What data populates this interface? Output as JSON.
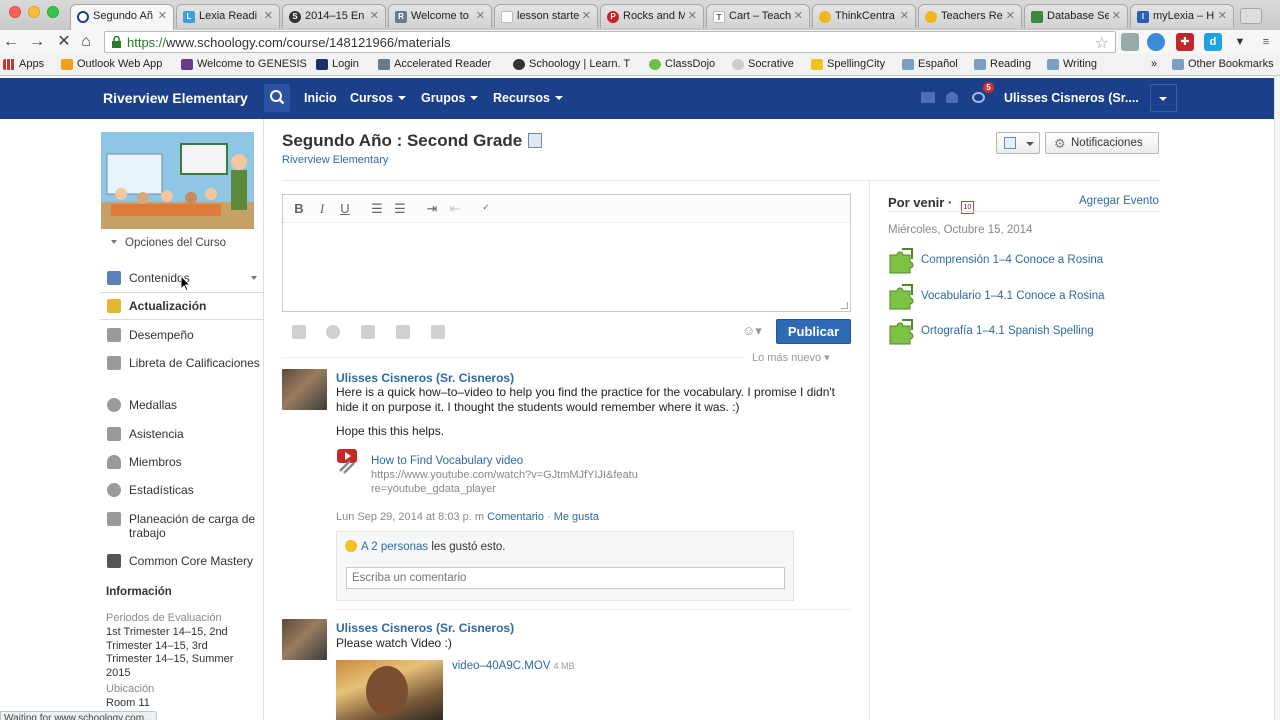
{
  "browser": {
    "tabs": [
      {
        "title": "Segundo Añ",
        "active": true,
        "icon_color": "#1c3f8a"
      },
      {
        "title": "Lexia Readi",
        "icon_color": "#3aa0d8"
      },
      {
        "title": "2014–15 En",
        "icon_color": "#333333"
      },
      {
        "title": "Welcome to",
        "icon_color": "#6b7b8c"
      },
      {
        "title": "lesson starte",
        "icon_color": "#ffffff"
      },
      {
        "title": "Rocks and M",
        "icon_color": "#cb2027"
      },
      {
        "title": "Cart – Teach",
        "icon_color": "#ffffff"
      },
      {
        "title": "ThinkCentra",
        "icon_color": "#f2b51c"
      },
      {
        "title": "Teachers Re",
        "icon_color": "#f2b51c"
      },
      {
        "title": "Database Se",
        "icon_color": "#3a8a3a"
      },
      {
        "title": "myLexia – H",
        "icon_color": "#2b5fb4"
      }
    ],
    "url_scheme": "https://",
    "url_rest": "www.schoology.com/course/148121966/materials",
    "bookmarks": [
      "Apps",
      "Outlook Web App",
      "Welcome to GENESIS",
      "Login",
      "Accelerated Reader",
      "Schoology | Learn. T",
      "ClassDojo",
      "Socrative",
      "SpellingCity",
      "Español",
      "Reading",
      "Writing"
    ],
    "other_bookmarks": "Other Bookmarks",
    "status": "Waiting for www.schoology.com..."
  },
  "header": {
    "brand": "Riverview Elementary",
    "nav": [
      "Inicio",
      "Cursos",
      "Grupos",
      "Recursos"
    ],
    "notification_count": "5",
    "user": "Ulisses Cisneros (Sr...."
  },
  "sidebar": {
    "course_options": "Opciones del Curso",
    "items": [
      {
        "label": "Contenidos",
        "icon_color": "#5b7fb8"
      },
      {
        "label": "Actualización",
        "icon_color": "#e5b834"
      },
      {
        "label": "Desempeño",
        "icon_color": "#8a8a8a"
      },
      {
        "label": "Libreta de Calificaciones",
        "icon_color": "#8a8a8a"
      },
      {
        "label": "Medallas",
        "icon_color": "#8a8a8a"
      },
      {
        "label": "Asistencia",
        "icon_color": "#8a8a8a"
      },
      {
        "label": "Miembros",
        "icon_color": "#8a8a8a"
      },
      {
        "label": "Estadísticas",
        "icon_color": "#8a8a8a"
      },
      {
        "label": "Planeación de carga de trabajo",
        "icon_color": "#8a8a8a"
      },
      {
        "label": "Common Core Mastery",
        "icon_color": "#8a8a8a"
      }
    ],
    "info_title": "Información",
    "grading_periods_label": "Periodos de Evaluación",
    "grading_periods": "1st Trimester 14–15, 2nd Trimester 14–15, 3rd Trimester 14–15, Summer 2015",
    "location_label": "Ubicación",
    "location": "Room 11"
  },
  "main": {
    "title": "Segundo Año : Second Grade",
    "school": "Riverview Elementary",
    "notifications_button": "Notificaciones",
    "publish_button": "Publicar",
    "sort_label": "Lo más nuevo ▾",
    "posts": [
      {
        "author": "Ulisses Cisneros (Sr. Cisneros)",
        "text": "Here is a quick how–to–video to help you find the practice for the vocabulary. I promise I didn't hide it on purpose it. I thought the students would remember where it was. :)",
        "text2": "Hope this this helps.",
        "link_title": "How to Find Vocabulary video",
        "link_url": "https://www.youtube.com/watch?v=GJtmMJfYIJI&feature=youtube_gdata_player",
        "timestamp": "Lun Sep 29, 2014 at 8:03 p. m",
        "comment_action": "Comentario",
        "like_action": "Me gusta",
        "likes_people": "A 2 personas",
        "likes_suffix": "les gustó esto.",
        "comment_placeholder": "Escriba un comentario"
      },
      {
        "author": "Ulisses Cisneros (Sr. Cisneros)",
        "text": "Please watch Video :)",
        "video_name": "video–40A9C.MOV",
        "video_size": "4 MB"
      }
    ]
  },
  "upcoming": {
    "title": "Por venir",
    "cal_day": "10",
    "add_event": "Agregar Evento",
    "date": "Miércoles, Octubre 15, 2014",
    "events": [
      "Comprensión 1–4 Conoce a Rosina",
      "Vocabulario 1–4.1 Conoce a Rosina",
      "Ortografía 1–4.1 Spanish Spelling"
    ]
  }
}
